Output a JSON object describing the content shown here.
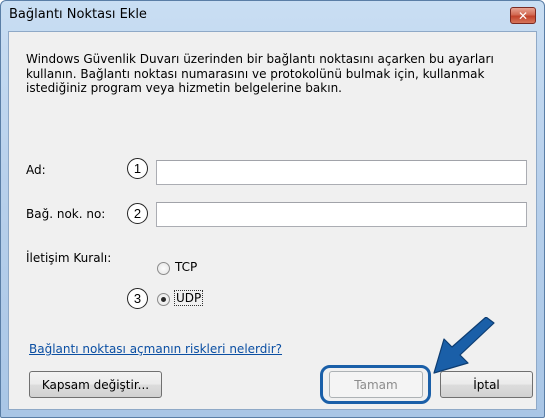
{
  "window": {
    "title": "Bağlantı Noktası Ekle",
    "close_glyph": "✕"
  },
  "intro_text": "Windows Güvenlik Duvarı üzerinden bir bağlantı noktasını açarken bu ayarları kullanın. Bağlantı noktası numarasını ve protokolünü bulmak için, kullanmak istediğiniz program veya hizmetin belgelerine bakın.",
  "fields": {
    "name": {
      "label": "Ad:",
      "callout": "1",
      "value": ""
    },
    "port": {
      "label": "Bağ. nok. no:",
      "callout": "2",
      "value": ""
    }
  },
  "protocol": {
    "label": "İletişim Kuralı:",
    "callout": "3",
    "options": [
      {
        "label": "TCP",
        "checked": false
      },
      {
        "label": "UDP",
        "checked": true
      }
    ]
  },
  "risk_link": "Bağlantı noktası açmanın riskleri nelerdir?",
  "buttons": {
    "scope": "Kapsam değiştir...",
    "ok": "Tamam",
    "cancel": "İptal"
  },
  "colors": {
    "callout_arrow": "#1a5fa8",
    "link": "#0b4fa3"
  }
}
